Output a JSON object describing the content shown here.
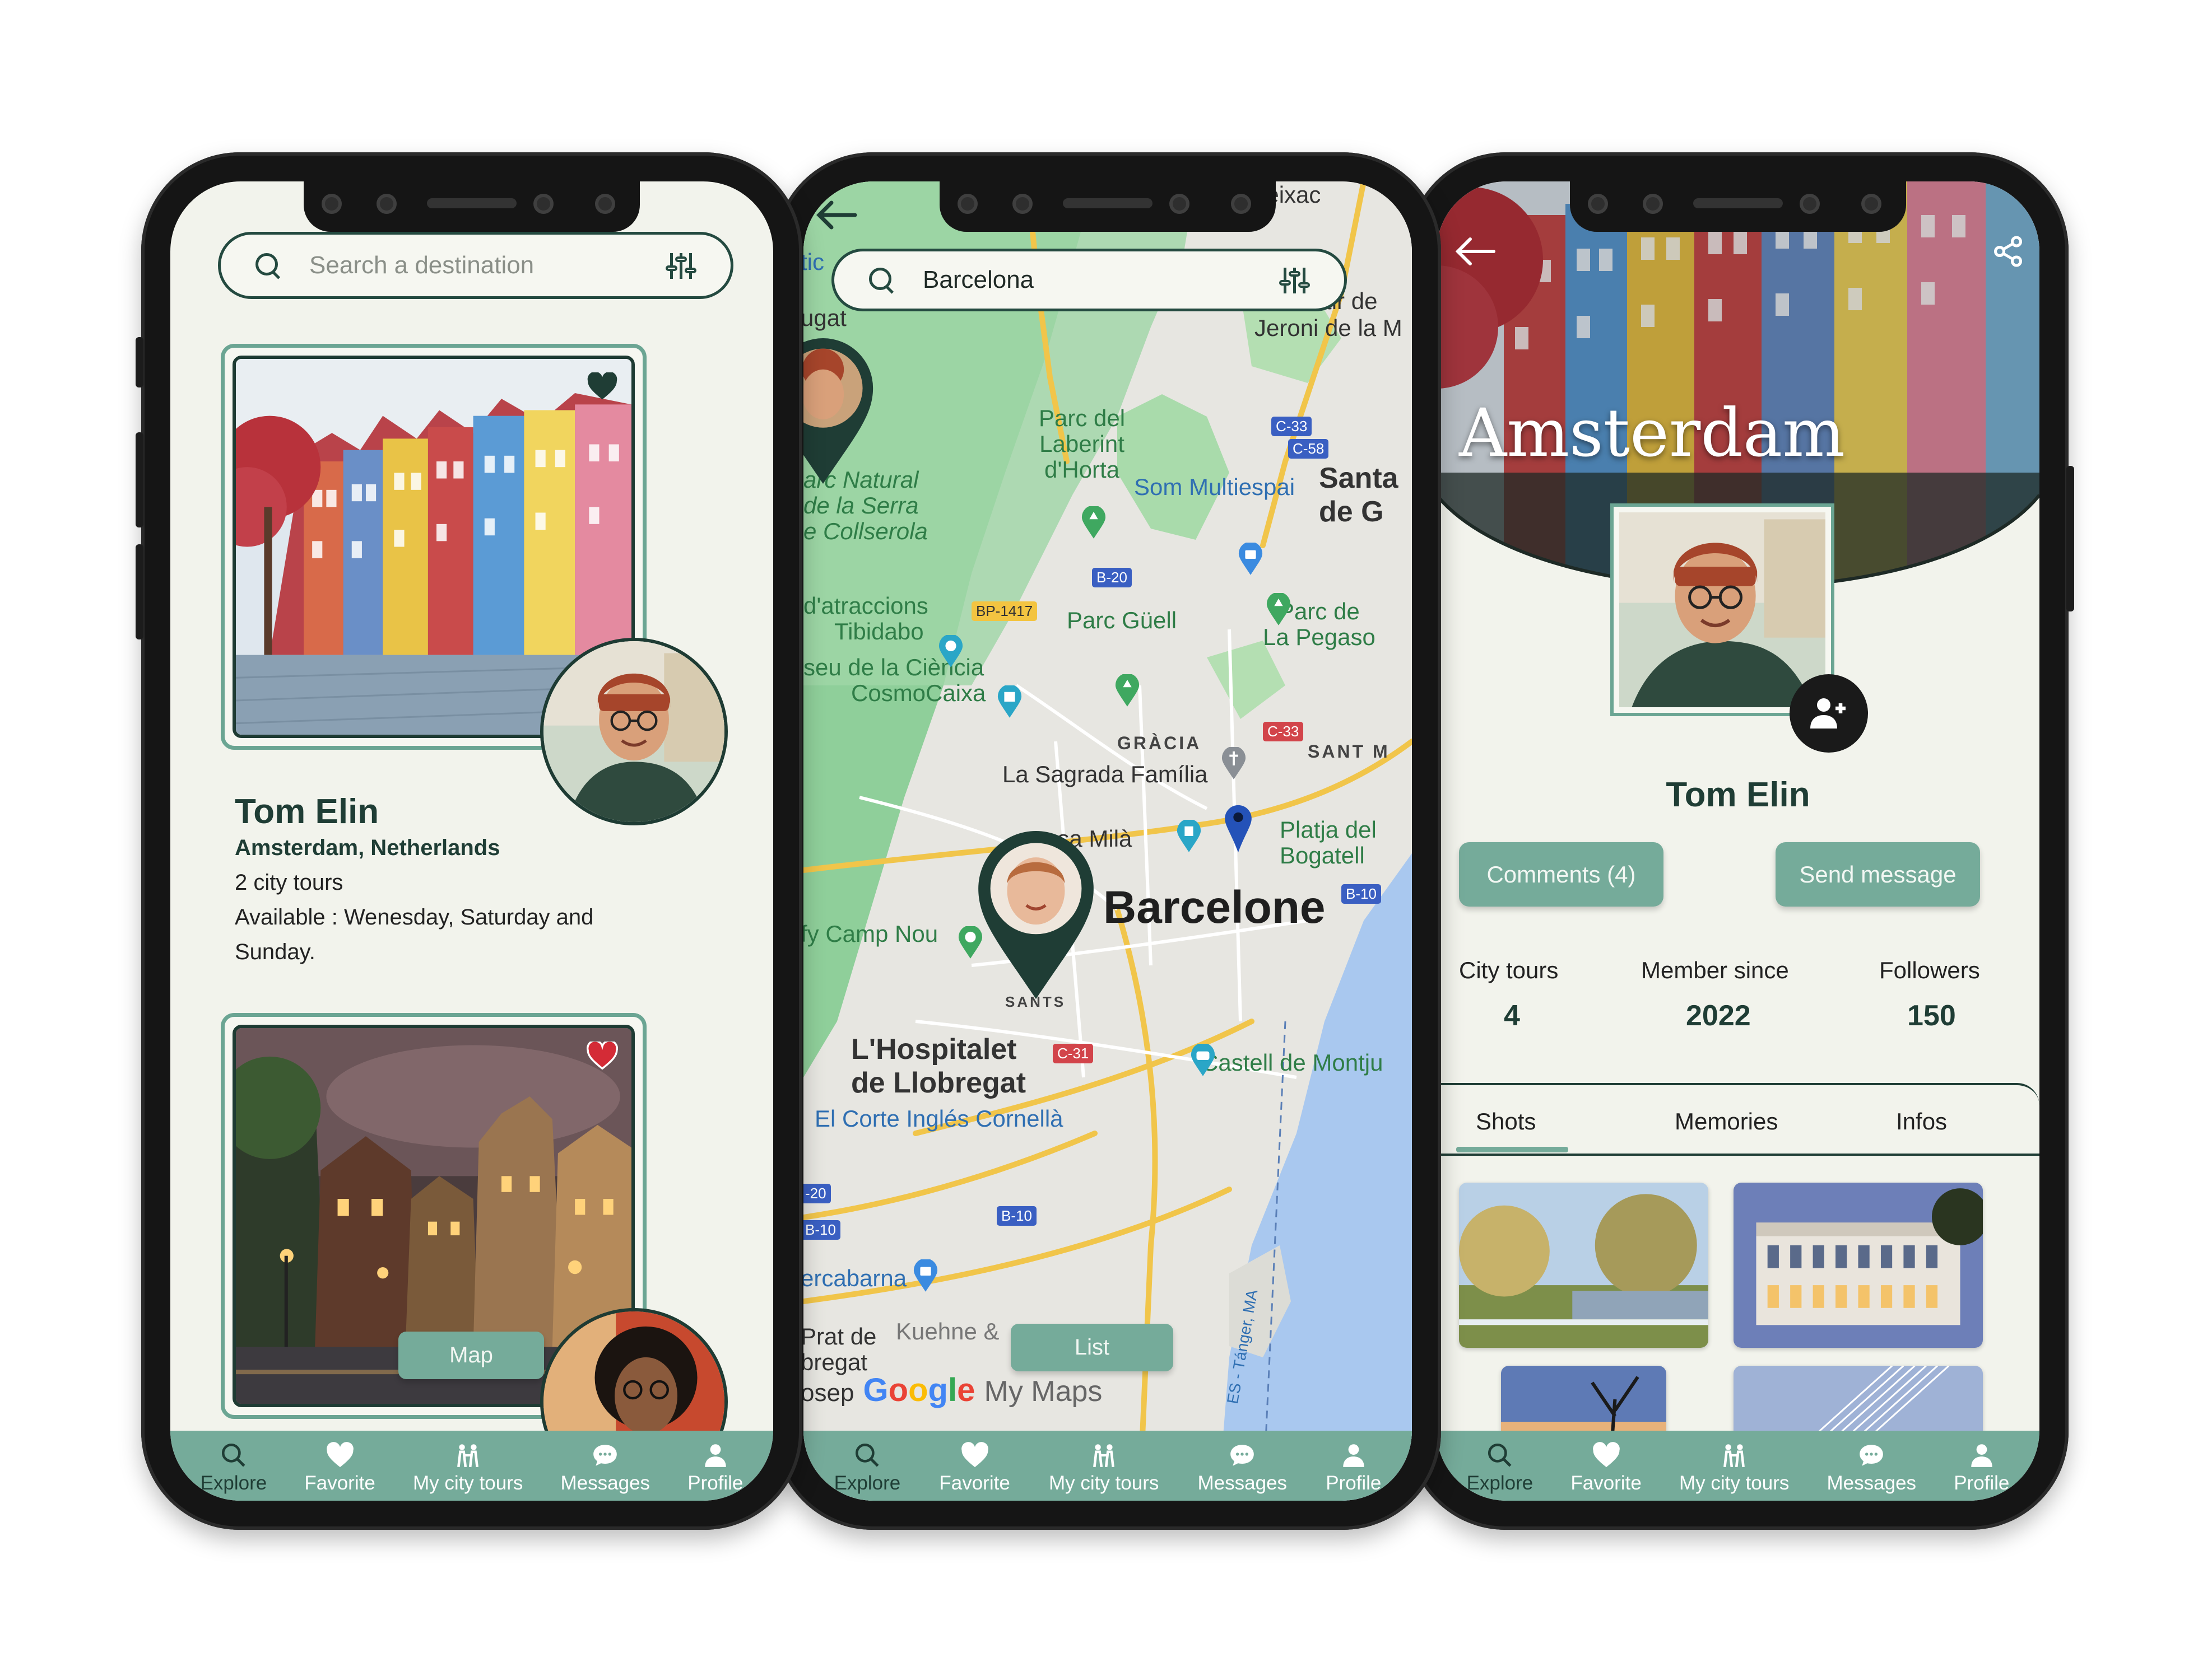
{
  "colors": {
    "accent": "#75ab9a",
    "dark_green": "#1f3d35",
    "screen_bg": "#f2f3ec",
    "heart_red": "#d42b36"
  },
  "nav": {
    "items": [
      {
        "label": "Explore",
        "icon": "search-icon"
      },
      {
        "label": "Favorite",
        "icon": "heart-icon"
      },
      {
        "label": "My city tours",
        "icon": "people-icon"
      },
      {
        "label": "Messages",
        "icon": "chat-icon"
      },
      {
        "label": "Profile",
        "icon": "user-icon"
      }
    ]
  },
  "phone1": {
    "search": {
      "placeholder": "Search a destination"
    },
    "card1": {
      "host_name": "Tom Elin",
      "location": "Amsterdam, Netherlands",
      "tours": "2 city tours",
      "availability_1": "Available : Wenesday, Saturday  and",
      "availability_2": "Sunday.",
      "favorited": true
    },
    "card2": {
      "favorited": true
    },
    "map_button": "Map"
  },
  "phone2": {
    "search": {
      "value": "Barcelona"
    },
    "list_button": "List",
    "map_labels": {
      "parc_laberint": [
        "Parc del",
        "Laberint",
        "d'Horta"
      ],
      "som_multiespai": "Som Multiespai",
      "santa": "Santa",
      "de_g": "de G",
      "parc_natural": [
        "arc Natural",
        "de la Serra",
        "e Collserola"
      ],
      "tibidabo": [
        "d'atraccions",
        "Tibidabo"
      ],
      "cosmocaixa": [
        "seu de la Ciència",
        "CosmoCaixa"
      ],
      "parc_guell": "Parc Güell",
      "parc_pegaso": [
        "Parc de",
        "La Pegaso"
      ],
      "gracia": "GRÀCIA",
      "sant_m": "SANT M",
      "sagrada": "La Sagrada Família",
      "casa_mila": "asa Milà",
      "platja": [
        "Platja del",
        "Bogatell"
      ],
      "barcelone": "Barcelone",
      "camp_nou": "fy Camp Nou",
      "sants": "SANTS",
      "hospitalet": [
        "L'Hospitalet",
        "de Llobregat"
      ],
      "montjuic": "Castell de Montju",
      "corte_ingles": "El Corte Inglés Cornellà",
      "cercabarna": "ercabarna",
      "prat": [
        "Prat de",
        "bregat"
      ],
      "kuehne": "Kuehne &",
      "reixac": "Reixac",
      "monestir": [
        "Monestir de",
        "Jeroni de la M"
      ],
      "gat": "ugat",
      "tic": "tic",
      "josep": "osep",
      "my_maps": "My Maps",
      "tanger": "ES - Tánger, MA",
      "roads": [
        "C-33",
        "C-58",
        "B-20",
        "BP-1417",
        "C-33",
        "B-10",
        "C-31",
        "-20",
        "B-10",
        "B-10"
      ]
    }
  },
  "phone3": {
    "city": "Amsterdam",
    "host_name": "Tom Elin",
    "comments_button": "Comments (4)",
    "message_button": "Send message",
    "stats": [
      {
        "label": "City tours",
        "value": "4"
      },
      {
        "label": "Member since",
        "value": "2022"
      },
      {
        "label": "Followers",
        "value": "150"
      }
    ],
    "tabs": [
      "Shots",
      "Memories",
      "Infos"
    ],
    "active_tab": "Shots"
  }
}
